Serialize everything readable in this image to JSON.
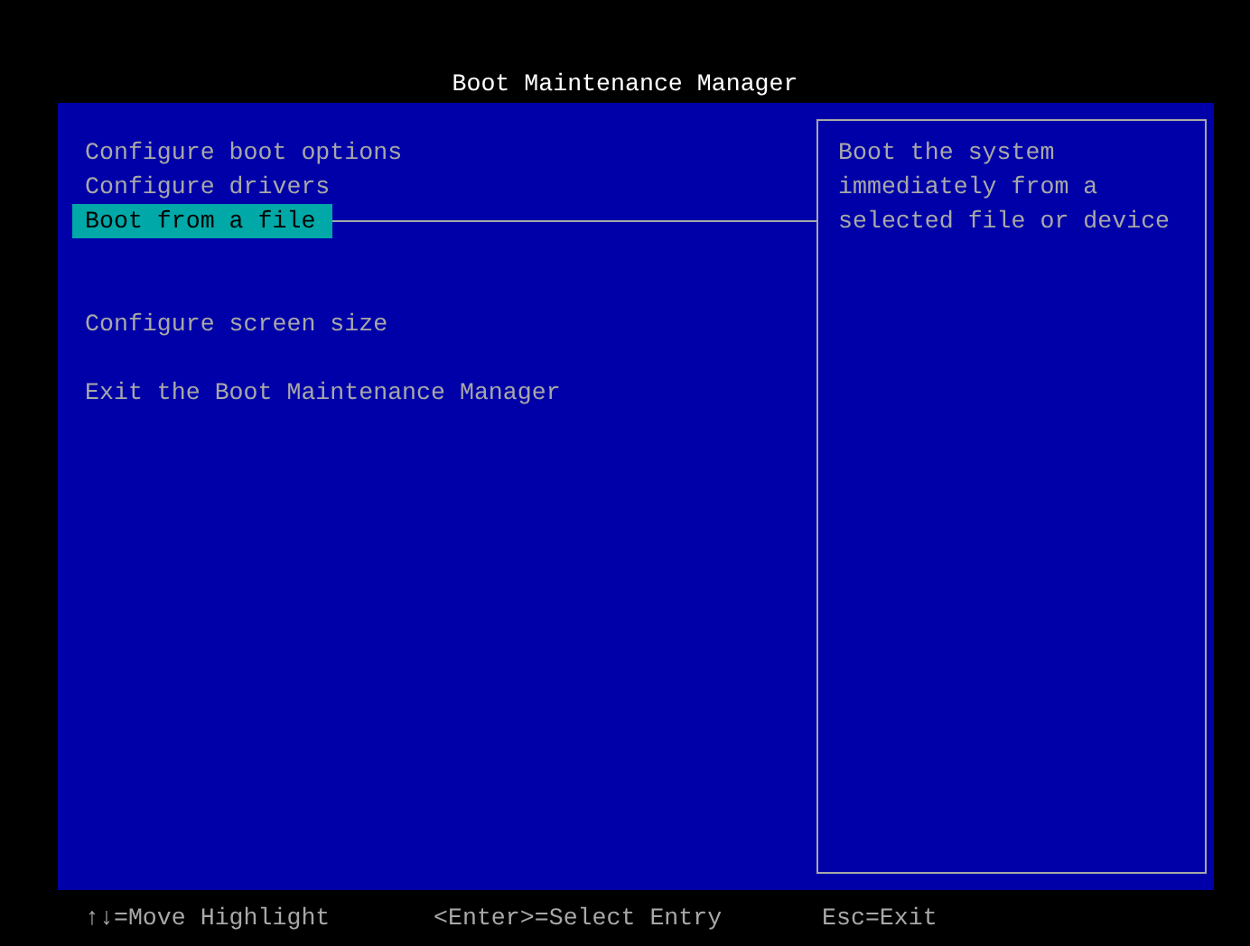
{
  "title": "Boot Maintenance Manager",
  "menu": [
    {
      "kind": "option",
      "label": "Configure boot options",
      "selected": false
    },
    {
      "kind": "option",
      "label": "Configure drivers",
      "selected": false
    },
    {
      "kind": "option",
      "label": "Boot from a file",
      "selected": true
    },
    {
      "kind": "spacer"
    },
    {
      "kind": "spacer"
    },
    {
      "kind": "option",
      "label": "Configure screen size",
      "selected": false
    },
    {
      "kind": "spacer"
    },
    {
      "kind": "option",
      "label": "Exit the Boot Maintenance Manager",
      "selected": false
    }
  ],
  "help_text": "Boot the system immediately from a selected file or device",
  "footer": [
    "↑↓=Move Highlight",
    "<Enter>=Select Entry",
    "Esc=Exit"
  ]
}
